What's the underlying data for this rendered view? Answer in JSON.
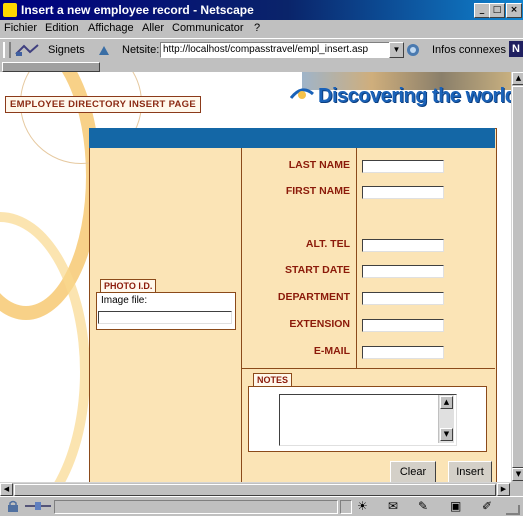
{
  "window": {
    "title": "Insert a new employee record - Netscape",
    "controls": [
      "minimize",
      "maximize",
      "close"
    ]
  },
  "menubar": {
    "items": [
      "Fichier",
      "Edition",
      "Affichage",
      "Aller",
      "Communicator",
      "?"
    ]
  },
  "location_bar": {
    "bookmarks_label": "Signets",
    "location_label": "Netsite:",
    "url": "http://localhost/compasstravel/empl_insert.asp",
    "related_label": "Infos connexes"
  },
  "page": {
    "section_label": "EMPLOYEE DIRECTORY INSERT PAGE",
    "brand": "Discovering the world",
    "fields": {
      "last_name": "LAST NAME",
      "first_name": "FIRST NAME",
      "alt_tel": "ALT. TEL",
      "start_date": "START DATE",
      "department": "DEPARTMENT",
      "extension": "EXTENSION",
      "email": "E-MAIL"
    },
    "photo": {
      "tab_label": "PHOTO I.D.",
      "image_file_label": "Image file:"
    },
    "notes_label": "NOTES",
    "buttons": {
      "clear": "Clear",
      "insert": "Insert"
    }
  },
  "colors": {
    "form_background": "#fbe4b6",
    "header_blue": "#1467a6",
    "label_red": "#8b1a0a",
    "brand_blue": "#1a62b8"
  }
}
